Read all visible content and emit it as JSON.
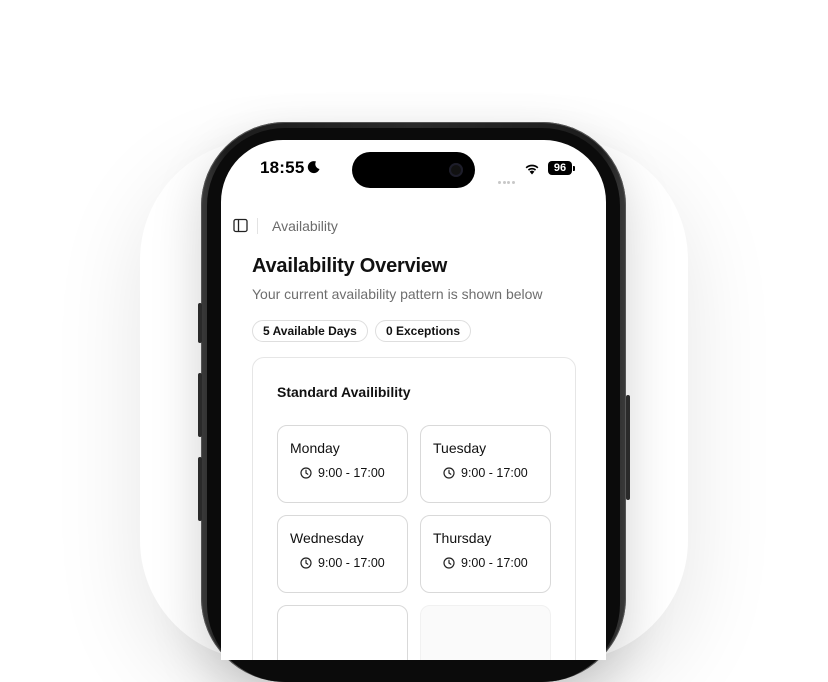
{
  "status_bar": {
    "time": "18:55",
    "battery": "96"
  },
  "topbar": {
    "breadcrumb": "Availability"
  },
  "page": {
    "title": "Availability Overview",
    "subtitle": "Your current availability pattern is shown below"
  },
  "badges": {
    "available_days": "5 Available Days",
    "exceptions": "0 Exceptions"
  },
  "standard": {
    "title": "Standard Availibility",
    "days": [
      {
        "name": "Monday",
        "hours": "9:00 - 17:00"
      },
      {
        "name": "Tuesday",
        "hours": "9:00 - 17:00"
      },
      {
        "name": "Wednesday",
        "hours": "9:00 - 17:00"
      },
      {
        "name": "Thursday",
        "hours": "9:00 - 17:00"
      }
    ]
  },
  "icons": {
    "sidebar": "sidebar-toggle-icon",
    "clock": "clock-icon",
    "moon": "moon-icon",
    "wifi": "wifi-icon"
  }
}
